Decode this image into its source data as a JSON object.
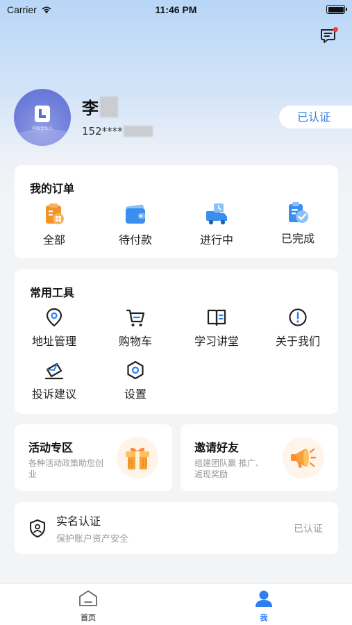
{
  "status_bar": {
    "carrier": "Carrier",
    "time": "11:46 PM"
  },
  "profile": {
    "name": "李",
    "phone": "152****",
    "avatar_caption": "中国合伙人",
    "verified_badge": "已认证"
  },
  "orders": {
    "title": "我的订单",
    "items": [
      {
        "label": "全部",
        "icon": "all-orders-icon"
      },
      {
        "label": "待付款",
        "icon": "wallet-icon"
      },
      {
        "label": "进行中",
        "icon": "delivery-truck-icon"
      },
      {
        "label": "已完成",
        "icon": "completed-clipboard-icon"
      }
    ]
  },
  "tools": {
    "title": "常用工具",
    "items": [
      {
        "label": "地址管理",
        "icon": "location-pin-icon"
      },
      {
        "label": "购物车",
        "icon": "cart-icon"
      },
      {
        "label": "学习讲堂",
        "icon": "book-icon"
      },
      {
        "label": "关于我们",
        "icon": "info-icon"
      },
      {
        "label": "投诉建议",
        "icon": "feedback-icon"
      },
      {
        "label": "设置",
        "icon": "hexagon-settings-icon"
      }
    ]
  },
  "promos": [
    {
      "title": "活动专区",
      "desc": "各种活动政策助您创业",
      "icon": "gift-box-icon"
    },
    {
      "title": "邀请好友",
      "desc": "组建团队赢 推广、返现奖励",
      "icon": "megaphone-icon"
    }
  ],
  "real_name": {
    "title": "实名认证",
    "subtitle": "保护账户资产安全",
    "status": "已认证",
    "icon": "shield-user-icon"
  },
  "tabbar": {
    "items": [
      {
        "label": "首页",
        "icon": "home-icon",
        "active": false
      },
      {
        "label": "我",
        "icon": "profile-icon",
        "active": true
      }
    ],
    "active_color": "#2d7ff0",
    "inactive_color": "#666666"
  },
  "colors": {
    "accent": "#2f7de1",
    "order_orange": "#f4922a",
    "order_blue": "#3a8ef0"
  }
}
